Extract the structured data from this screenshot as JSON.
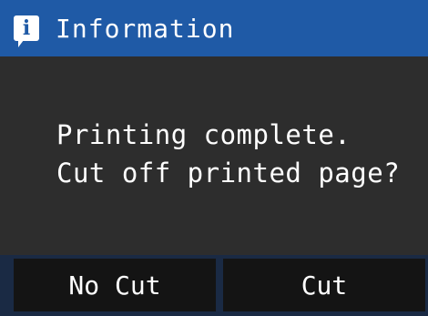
{
  "dialog": {
    "title": "Information",
    "icon": "info-icon",
    "message_line1": "Printing complete.",
    "message_line2": "Cut off printed page?"
  },
  "buttons": {
    "no_cut_label": "No Cut",
    "cut_label": "Cut"
  },
  "colors": {
    "title_bar": "#1f5aa6",
    "background": "#2d2d2d",
    "button": "#141414",
    "text": "#ffffff"
  }
}
